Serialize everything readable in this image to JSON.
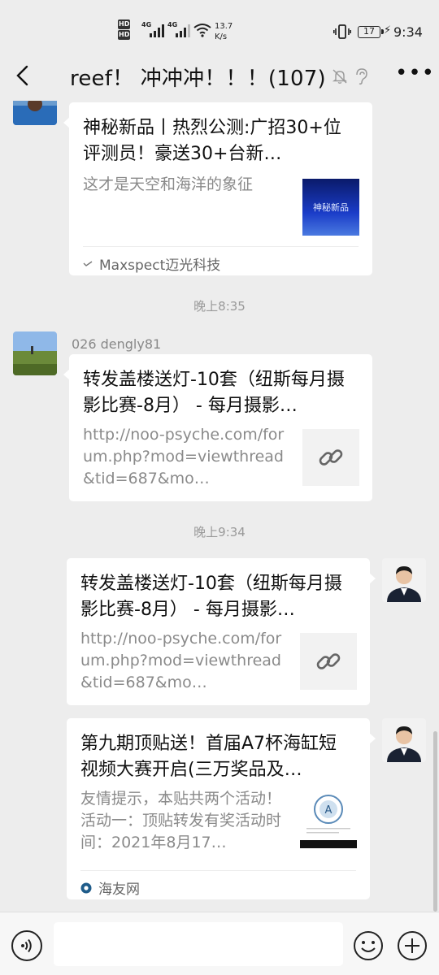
{
  "status_bar": {
    "hd_1": "HD",
    "hd_2": "HD",
    "net_1": "4G",
    "net_2": "4G",
    "speed_value": "13.7",
    "speed_unit": "K/s",
    "battery": "17",
    "time": "9:34"
  },
  "nav": {
    "title": "reef！ 冲冲冲！！！(107)"
  },
  "messages": {
    "msg1": {
      "title": "神秘新品丨热烈公测:广招30+位评测员！豪送30+台新…",
      "description": "这才是天空和海洋的象征",
      "thumb_caption": "神秘新品",
      "source": "Maxspect迈光科技"
    },
    "time1": "晚上8:35",
    "msg2": {
      "sender": "026 dengly81",
      "title": "转发盖楼送灯-10套（纽斯每月摄影比赛-8月） - 每月摄影…",
      "description": "http://noo-psyche.com/forum.php?mod=viewthread&tid=687&mo…"
    },
    "time2": "晚上9:34",
    "msg3": {
      "title": "转发盖楼送灯-10套（纽斯每月摄影比赛-8月） - 每月摄影…",
      "description": "http://noo-psyche.com/forum.php?mod=viewthread&tid=687&mo…"
    },
    "msg4": {
      "title": "第九期顶贴送！首届A7杯海缸短视频大赛开启(三万奖品及…",
      "description": "友情提示，本贴共两个活动！活动一：顶贴转发有奖活动时间：2021年8月17…",
      "source": "海友网"
    }
  },
  "input": {
    "value": ""
  },
  "colors": {
    "background": "#ededed",
    "card": "#ffffff",
    "muted_text": "#8a8a8a"
  }
}
